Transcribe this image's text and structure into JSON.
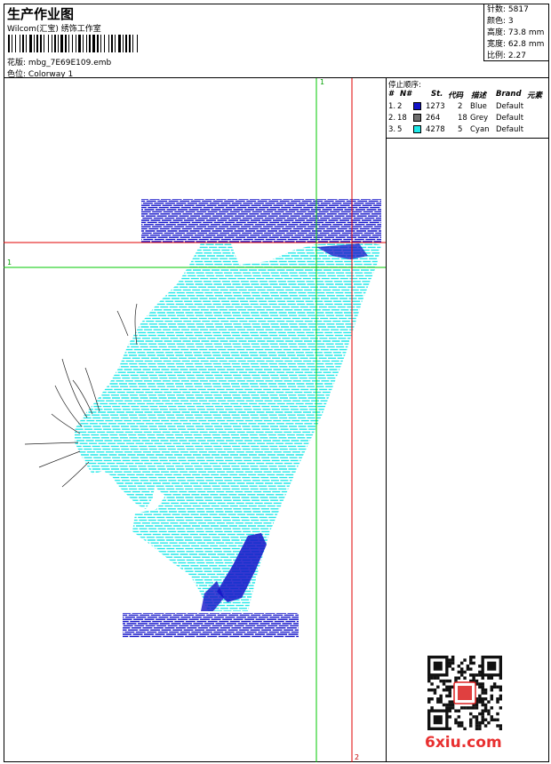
{
  "header": {
    "title": "生产作业图",
    "company": "Wilcom(汇宝) 绣饰工作室",
    "design_label": "花版:",
    "design_value": "mbg_7E69E109.emb",
    "colorway_label": "色位:",
    "colorway_value": "Colorway 1"
  },
  "stats": {
    "stitches_label": "针数:",
    "stitches_value": "5817",
    "colors_label": "颜色:",
    "colors_value": "3",
    "height_label": "高度:",
    "height_value": "73.8 mm",
    "width_label": "宽度:",
    "width_value": "62.8 mm",
    "scale_label": "比例:",
    "scale_value": "2.27"
  },
  "stop_sequence": {
    "title": "停止顺序:",
    "headers": [
      "#",
      "N#",
      "St.",
      "代码",
      "描述",
      "Brand",
      "元素"
    ],
    "rows": [
      {
        "index": "1.",
        "n": "2",
        "stitches": "1273",
        "code": "2",
        "desc": "Blue",
        "brand": "Default",
        "color": "#1313c8"
      },
      {
        "index": "2.",
        "n": "18",
        "stitches": "264",
        "code": "18",
        "desc": "Grey",
        "brand": "Default",
        "color": "#6e6e6e"
      },
      {
        "index": "3.",
        "n": "5",
        "stitches": "4278",
        "code": "5",
        "desc": "Cyan",
        "brand": "Default",
        "color": "#20e8e8"
      }
    ]
  },
  "guides": {
    "green_v_label": "1",
    "green_h_label": "1",
    "red_v_label": "2"
  },
  "colors": {
    "blue": "#1313c8",
    "cyan": "#20e8e8",
    "green_guide": "#00c800",
    "red_guide": "#e00000"
  },
  "watermark": "6xiu.com"
}
